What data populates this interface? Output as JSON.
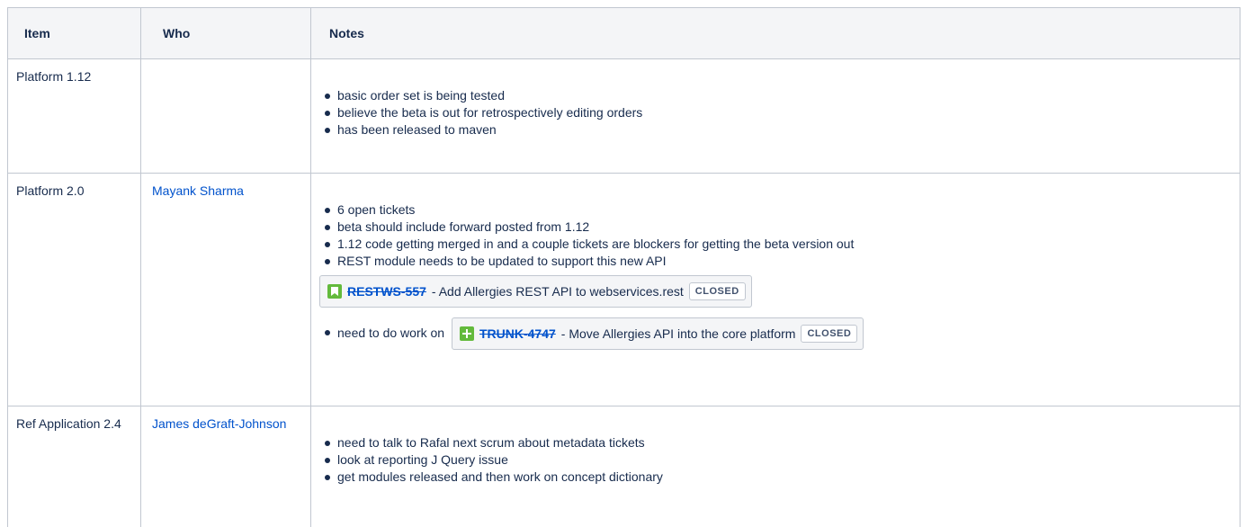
{
  "table": {
    "headers": {
      "item": "Item",
      "who": "Who",
      "notes": "Notes"
    },
    "rows": [
      {
        "item": "Platform 1.12",
        "who": "",
        "notes": [
          "basic order set is being tested",
          "believe the beta is out for retrospectively editing orders",
          "has been released to maven"
        ]
      },
      {
        "item": "Platform 2.0",
        "who": "Mayank Sharma",
        "notes": [
          "6 open tickets",
          "beta should include forward posted from 1.12",
          "1.12 code getting merged in and a couple tickets are blockers for getting the beta version out",
          "REST module needs to be updated to support this new API"
        ],
        "jira_block": {
          "icon": "bookmark-icon",
          "key": "RESTWS-557",
          "summary": " - Add Allergies REST API to webservices.rest",
          "status": "CLOSED"
        },
        "inline_note": {
          "text": "need to do work on",
          "icon": "plus-icon",
          "key": "TRUNK-4747",
          "summary": " - Move Allergies API into the core platform",
          "status": "CLOSED"
        }
      },
      {
        "item": "Ref Application 2.4",
        "who": "James deGraft-Johnson",
        "notes": [
          "need to talk to Rafal next scrum about metadata tickets",
          "look at reporting J Query issue",
          "get modules released and then work on concept dictionary"
        ]
      }
    ]
  },
  "colors": {
    "link": "#0052cc",
    "issue_icon": "#63ba3c",
    "header_bg": "#f4f5f7",
    "border": "#c1c7d0"
  }
}
